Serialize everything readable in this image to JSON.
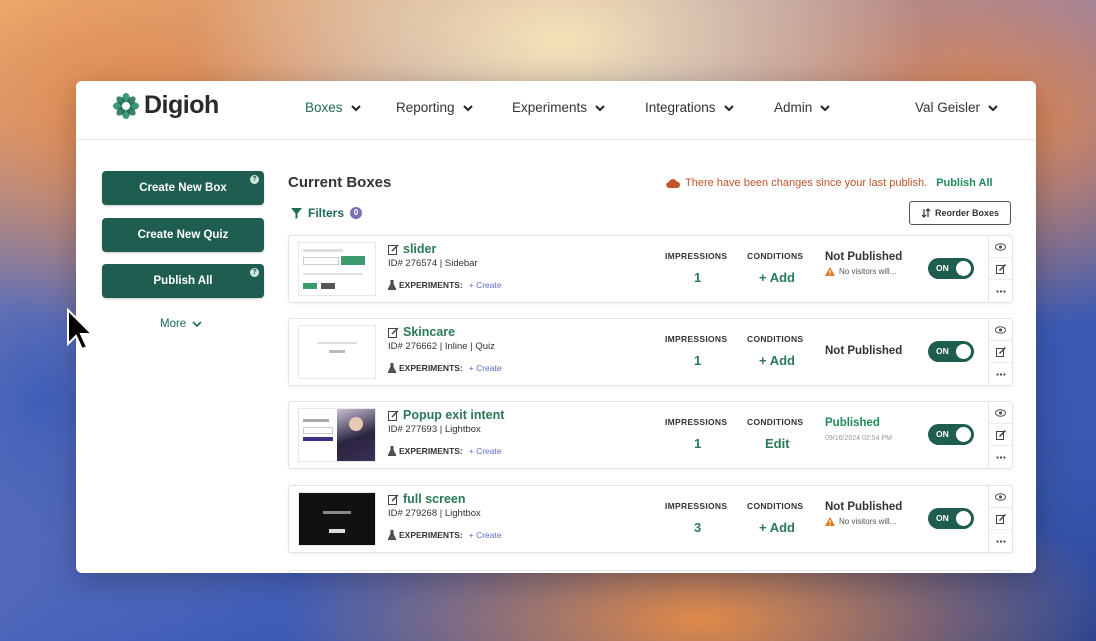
{
  "brand": {
    "name": "Digioh",
    "accent": "#1f5d50",
    "link": "#2a7a55"
  },
  "nav": {
    "items": [
      "Boxes",
      "Reporting",
      "Experiments",
      "Integrations",
      "Admin"
    ],
    "user": "Val Geisler"
  },
  "sidebar": {
    "create_box": "Create New Box",
    "create_quiz": "Create New Quiz",
    "publish_all": "Publish All",
    "more": "More"
  },
  "main": {
    "title": "Current Boxes",
    "filters_label": "Filters",
    "filters_count": "0",
    "changes_notice": "There have been changes since your last publish.",
    "publish_all_link": "Publish All",
    "reorder_label": "Reorder Boxes",
    "impressions_header": "IMPRESSIONS",
    "conditions_header": "CONDITIONS",
    "experiments_label": "EXPERIMENTS:",
    "create_label": "+ Create",
    "toggle_label": "ON"
  },
  "boxes": [
    {
      "name": "slider",
      "id_line": "ID# 276574 | Sidebar",
      "impressions": "1",
      "conditions": "+ Add",
      "status": "Not Published",
      "status_note": "No visitors will...",
      "status_date": ""
    },
    {
      "name": "Skincare",
      "id_line": "ID# 276662 | Inline | Quiz",
      "impressions": "1",
      "conditions": "+ Add",
      "status": "Not Published",
      "status_note": "",
      "status_date": ""
    },
    {
      "name": "Popup exit intent",
      "id_line": "ID# 277693 | Lightbox",
      "impressions": "1",
      "conditions": "Edit",
      "status": "Published",
      "status_note": "",
      "status_date": "09/16/2024 02:54 PM"
    },
    {
      "name": "full screen",
      "id_line": "ID# 279268 | Lightbox",
      "impressions": "3",
      "conditions": "+ Add",
      "status": "Not Published",
      "status_note": "No visitors will...",
      "status_date": ""
    }
  ]
}
